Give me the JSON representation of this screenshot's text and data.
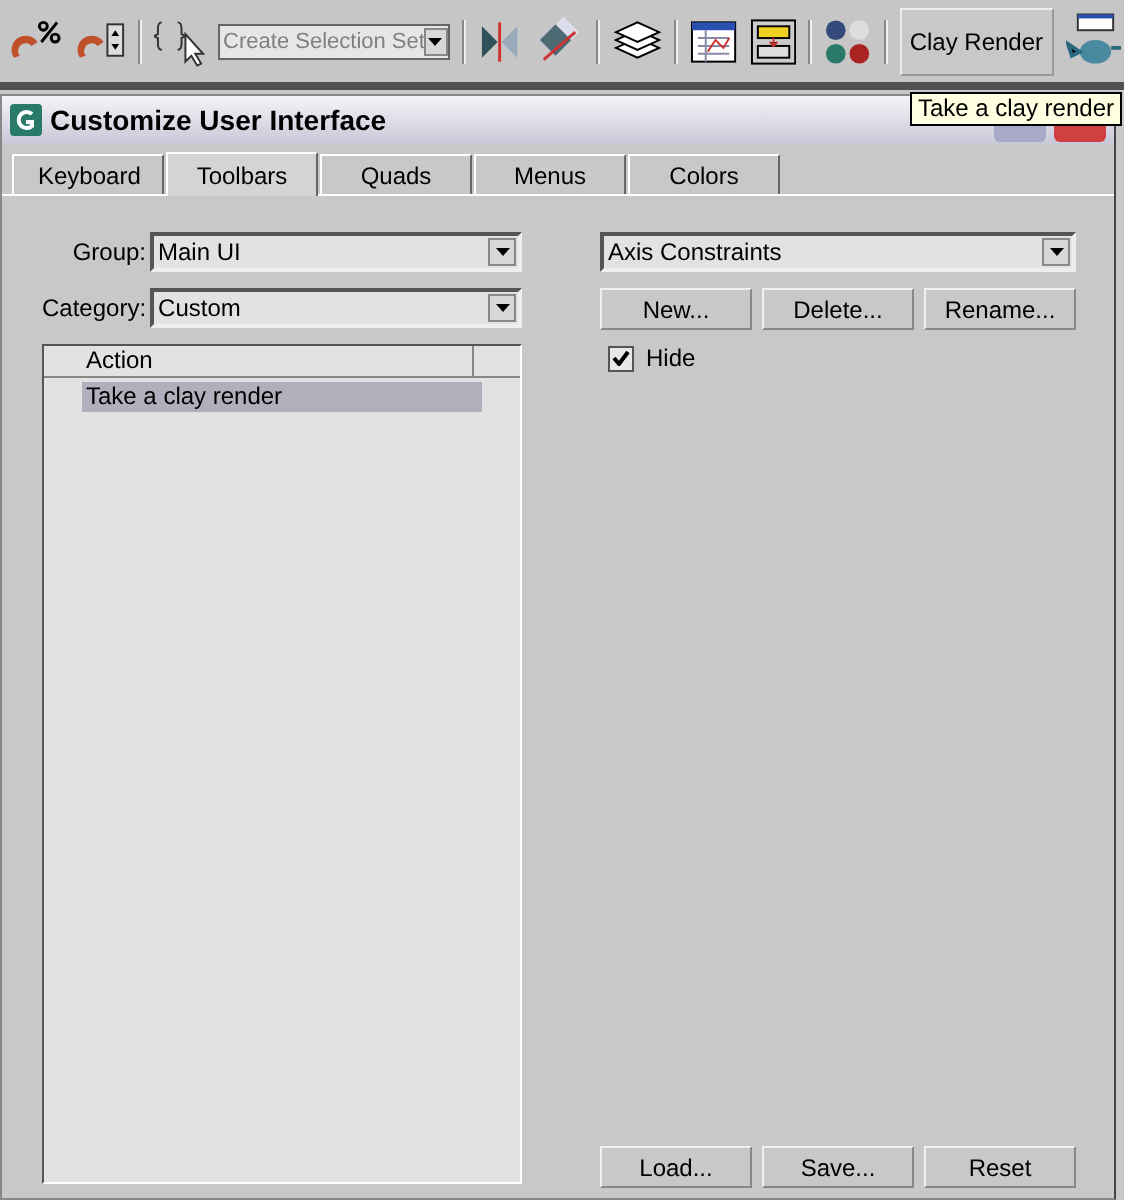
{
  "toolbar": {
    "selection_set": {
      "placeholder": "Create Selection Set"
    },
    "clay_render_button": "Clay Render"
  },
  "tooltip": "Take a clay render",
  "dialog": {
    "title": "Customize User Interface",
    "tabs": [
      {
        "label": "Keyboard",
        "selected": false
      },
      {
        "label": "Toolbars",
        "selected": true
      },
      {
        "label": "Quads",
        "selected": false
      },
      {
        "label": "Menus",
        "selected": false
      },
      {
        "label": "Colors",
        "selected": false
      }
    ],
    "group": {
      "label": "Group:",
      "value": "Main UI"
    },
    "category": {
      "label": "Category:",
      "value": "Custom"
    },
    "action_list": {
      "columns": [
        "Action"
      ],
      "rows": [
        {
          "text": "Take a clay render",
          "selected": true
        }
      ]
    },
    "toolbar_select": {
      "value": "Axis Constraints"
    },
    "buttons": [
      "New...",
      "Delete...",
      "Rename..."
    ],
    "hide": {
      "label": "Hide",
      "checked": true
    },
    "bottom_buttons": [
      "Load...",
      "Save...",
      "Reset"
    ]
  }
}
